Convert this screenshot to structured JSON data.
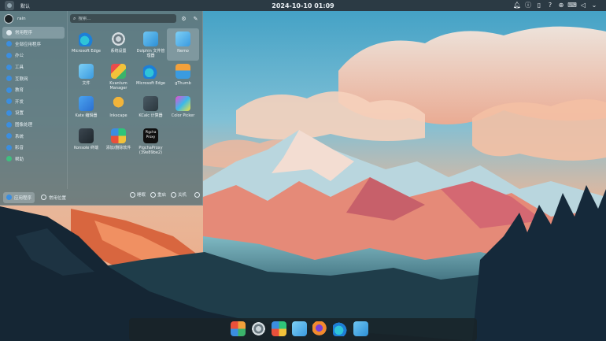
{
  "topbar": {
    "window_title": "默认",
    "clock": "2024-10-10 01:09",
    "tray": [
      "bell-icon",
      "info-icon",
      "clipboard-icon",
      "help-icon",
      "globe-icon",
      "keyboard-icon",
      "volume-icon",
      "chevron-down-icon"
    ]
  },
  "menu": {
    "user": {
      "name": "rain"
    },
    "search": {
      "placeholder": "搜索..."
    },
    "categories": [
      {
        "label": "常用程序",
        "icon": "bookmark-icon",
        "color": "#dfe9ee",
        "active": true
      },
      {
        "label": "全部应用程序",
        "icon": "apps-icon",
        "color": "#3b8ee0"
      },
      {
        "label": "办公",
        "icon": "office-icon",
        "color": "#3b8ee0"
      },
      {
        "label": "工具",
        "icon": "tools-icon",
        "color": "#3b8ee0"
      },
      {
        "label": "互联网",
        "icon": "internet-icon",
        "color": "#3b8ee0"
      },
      {
        "label": "教育",
        "icon": "education-icon",
        "color": "#3b8ee0"
      },
      {
        "label": "开发",
        "icon": "development-icon",
        "color": "#3b8ee0"
      },
      {
        "label": "设置",
        "icon": "settings-icon",
        "color": "#3b8ee0"
      },
      {
        "label": "图像处理",
        "icon": "graphics-icon",
        "color": "#3b8ee0"
      },
      {
        "label": "系统",
        "icon": "system-icon",
        "color": "#3b8ee0"
      },
      {
        "label": "影音",
        "icon": "multimedia-icon",
        "color": "#3b8ee0"
      },
      {
        "label": "帮助",
        "icon": "help-icon",
        "color": "#3fbf7f"
      }
    ],
    "apps": [
      {
        "label": "Microsoft Edge",
        "icon": "edge-icon"
      },
      {
        "label": "系统设置",
        "icon": "system-settings-icon"
      },
      {
        "label": "Dolphin 文件管理器",
        "icon": "dolphin-icon"
      },
      {
        "label": "Nemo",
        "icon": "nemo-icon",
        "selected": true
      },
      {
        "label": "文件",
        "icon": "files-icon"
      },
      {
        "label": "Kvantum Manager",
        "icon": "kvantum-icon"
      },
      {
        "label": "Microsoft Edge",
        "icon": "edge-icon"
      },
      {
        "label": "gThumb",
        "icon": "gthumb-icon"
      },
      {
        "label": "Kate 编辑器",
        "icon": "kate-icon"
      },
      {
        "label": "Inkscape",
        "icon": "inkscape-icon"
      },
      {
        "label": "KCalc 计算器",
        "icon": "kcalc-icon"
      },
      {
        "label": "Color Picker",
        "icon": "color-picker-icon"
      },
      {
        "label": "Konsole 终端",
        "icon": "konsole-icon"
      },
      {
        "label": "添加/删除软件",
        "icon": "software-store-icon"
      },
      {
        "label": "PigchaProxy (39e89be2)",
        "icon": "pigcha-proxy-icon",
        "icon_text": "Pigcha Proxy"
      }
    ],
    "bottom": {
      "tabs": [
        {
          "label": "应用程序",
          "active": true
        },
        {
          "label": "常用位置"
        }
      ],
      "power": [
        {
          "label": "睡眠",
          "icon": "sleep-icon"
        },
        {
          "label": "重启",
          "icon": "restart-icon"
        },
        {
          "label": "关机",
          "icon": "shutdown-icon"
        }
      ],
      "more_icon": "more-icon"
    }
  },
  "dock": {
    "items": [
      "app-launcher-icon",
      "system-settings-icon",
      "software-store-icon",
      "files-icon",
      "firefox-icon",
      "edge-icon",
      "dolphin-icon"
    ]
  }
}
